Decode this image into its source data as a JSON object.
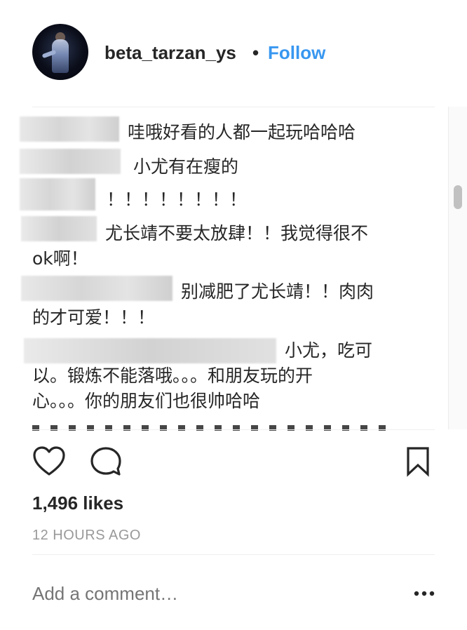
{
  "post": {
    "username": "beta_tarzan_ys",
    "separator": "•",
    "follow_label": "Follow"
  },
  "comments": [
    {
      "text": "哇哦好看的人都一起玩哈哈哈"
    },
    {
      "text": "小尤有在瘦的"
    },
    {
      "text": "！！！！！！！！"
    },
    {
      "line1": "尤长靖不要太放肆！！我觉得很不",
      "line2": "ok啊！"
    },
    {
      "line1": "别减肥了尤长靖！！肉肉",
      "line2": "的才可爱！！！"
    },
    {
      "line1": "小尤，吃可",
      "line2": "以。锻炼不能落哦。。。和朋友玩的开",
      "line3": "心。。。你的朋友们也很帅哈哈"
    }
  ],
  "actions": {
    "like_icon": "heart-icon",
    "comment_icon": "speech-bubble-icon",
    "save_icon": "bookmark-icon"
  },
  "likes": "1,496 likes",
  "timestamp": "12 HOURS AGO",
  "add_comment": {
    "placeholder": "Add a comment…",
    "more_icon": "ellipsis-icon"
  }
}
